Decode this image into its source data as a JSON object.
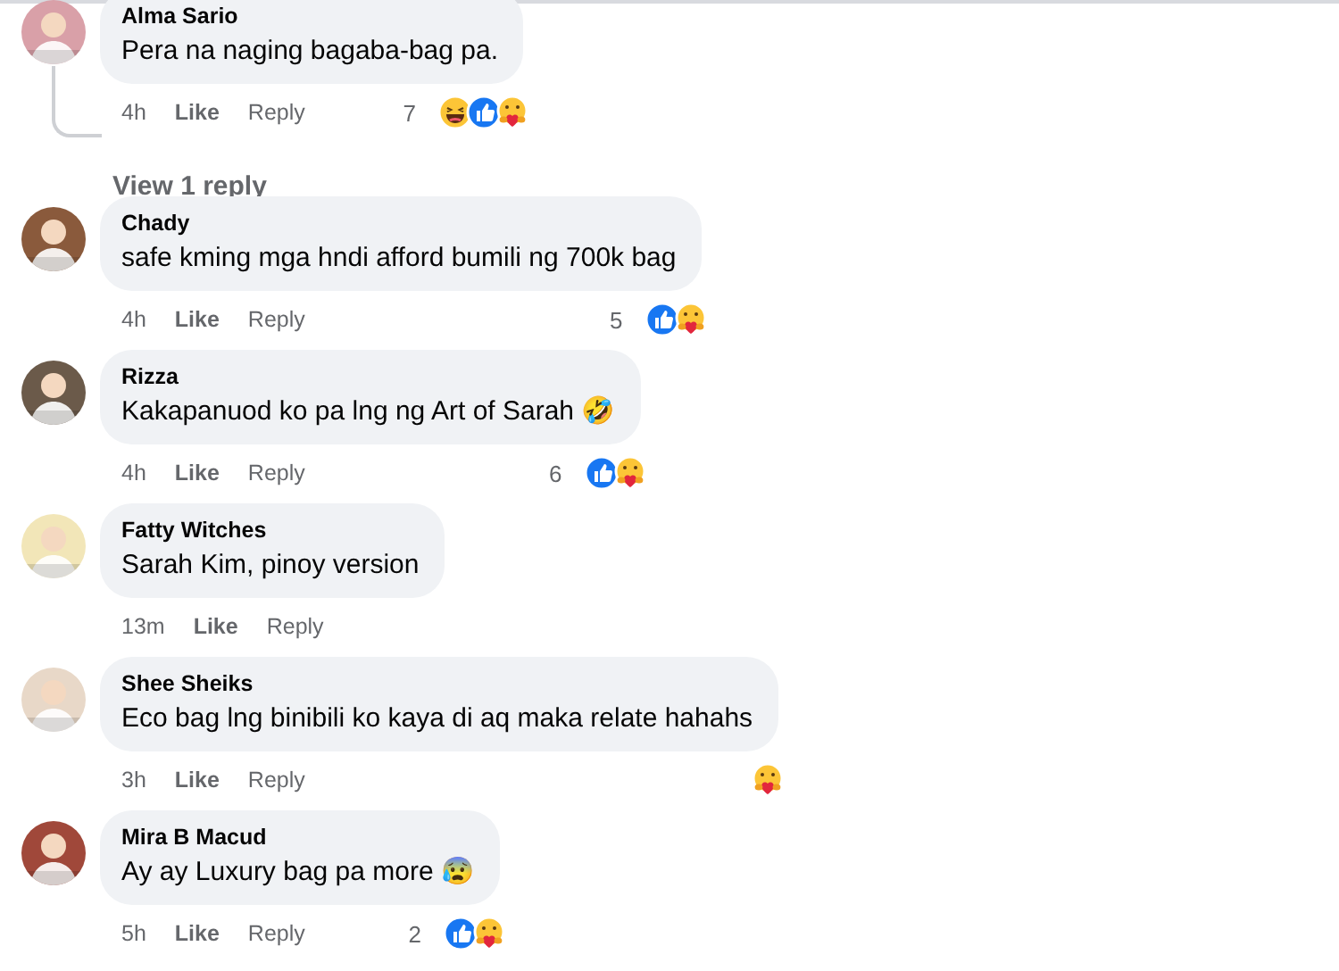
{
  "comments": [
    {
      "author": "Alma Sario",
      "text": "Pera na naging bagaba-bag pa.",
      "time": "4h",
      "like": "Like",
      "reply": "Reply",
      "reaction_count": "7",
      "reactions": [
        {
          "kind": "haha"
        },
        {
          "kind": "like"
        },
        {
          "kind": "care"
        }
      ],
      "view_replies": "View 1 reply"
    },
    {
      "author": "Chady",
      "text": "safe kming mga hndi afford bumili ng 700k bag",
      "time": "4h",
      "like": "Like",
      "reply": "Reply",
      "reaction_count": "5",
      "reactions": [
        {
          "kind": "like"
        },
        {
          "kind": "care"
        }
      ]
    },
    {
      "author": "Rizza",
      "text": "Kakapanuod ko pa lng ng Art of Sarah 🤣",
      "time": "4h",
      "like": "Like",
      "reply": "Reply",
      "reaction_count": "6",
      "reactions": [
        {
          "kind": "like"
        },
        {
          "kind": "care"
        }
      ]
    },
    {
      "author": "Fatty Witches",
      "text": "Sarah Kim, pinoy version",
      "time": "13m",
      "like": "Like",
      "reply": "Reply"
    },
    {
      "author": "Shee Sheiks",
      "text": "Eco bag lng binibili ko kaya di aq maka relate hahahs",
      "time": "3h",
      "like": "Like",
      "reply": "Reply",
      "reactions": [
        {
          "kind": "care"
        }
      ]
    },
    {
      "author": "Mira B Macud",
      "text": "Ay ay Luxury bag pa more 😰",
      "time": "5h",
      "like": "Like",
      "reply": "Reply",
      "reaction_count": "2",
      "reactions": [
        {
          "kind": "like"
        },
        {
          "kind": "care"
        }
      ]
    }
  ]
}
